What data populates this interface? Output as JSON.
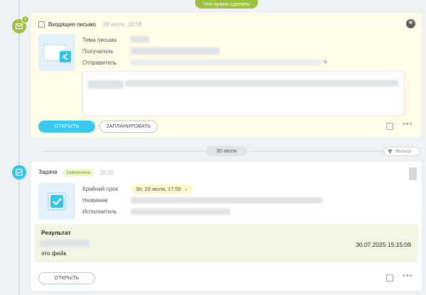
{
  "banner": {
    "label": "Что нужно сделать"
  },
  "email_card": {
    "badge_count": "1",
    "title": "Входящее письмо",
    "timestamp": "29 июля, 16:58",
    "fields": {
      "subject_label": "Тема письма",
      "recipient_label": "Получатель",
      "sender_label": "Отправитель",
      "sender_suffix": "u"
    },
    "buttons": {
      "open": "ОТКРЫТЬ",
      "schedule": "ЗАПЛАНИРОВАТЬ"
    }
  },
  "date_separator": {
    "label": "30 июля"
  },
  "filter": {
    "label": "Фильтр"
  },
  "task_card": {
    "title": "Задача",
    "status": "Завершена",
    "time": "15:15",
    "fields": {
      "deadline_label": "Крайний срок",
      "deadline_value": "Вт, 29 июля, 17:59",
      "name_label": "Название",
      "assignee_label": "Исполнитель"
    },
    "result": {
      "title": "Результат",
      "text": "это фейк",
      "datetime": "30.07.2025 15:15:09"
    },
    "buttons": {
      "open": "ОТКРЫТЬ"
    }
  },
  "colors": {
    "accent_green": "#9dc13e",
    "accent_blue": "#2fc5e8",
    "button_blue": "#3bc8ef",
    "email_card_bg": "#fffde8",
    "result_bg": "#f3f6e3"
  },
  "icons": {
    "email_badge": "envelope-icon",
    "task_badge": "checkbox-icon",
    "filter": "funnel-icon",
    "note": "note-icon",
    "more": "more-dots-icon"
  }
}
